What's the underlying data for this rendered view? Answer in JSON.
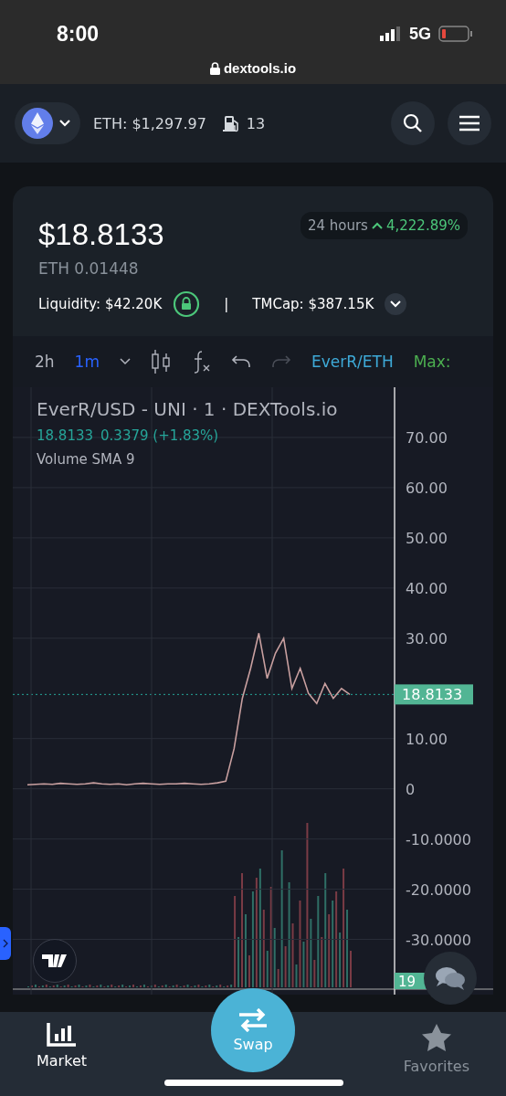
{
  "status_bar": {
    "time": "8:00",
    "network": "5G"
  },
  "address_bar": {
    "url": "dextools.io"
  },
  "header": {
    "eth_price": "ETH: $1,297.97",
    "gas": "13"
  },
  "token": {
    "price": "$18.8133",
    "eth_price": "ETH 0.01448",
    "period": "24 hours",
    "change": "4,222.89%",
    "liquidity": "Liquidity: $42.20K",
    "separator": "|",
    "tmcap": "TMCap: $387.15K"
  },
  "toolbar": {
    "range": "2h",
    "interval": "1m",
    "pair": "EverR/ETH",
    "max": "Max:"
  },
  "chart": {
    "title": "EverR/USD - UNI · 1 · DEXTools.io",
    "last": "18.8133",
    "change": "0.3379 (+1.83%)",
    "indicator": "Volume SMA 9",
    "price_tag": "18.8133",
    "volume_tag": "19",
    "chart_data": {
      "type": "line",
      "ylim": [
        -41,
        80
      ],
      "grid": true,
      "yticks": [
        {
          "value": 70,
          "label": "70.00"
        },
        {
          "value": 60,
          "label": "60.00"
        },
        {
          "value": 50,
          "label": "50.00"
        },
        {
          "value": 40,
          "label": "40.00"
        },
        {
          "value": 30,
          "label": "30.00"
        },
        {
          "value": 10,
          "label": "10.00"
        },
        {
          "value": 0,
          "label": "0"
        },
        {
          "value": -10,
          "label": "-10.0000"
        },
        {
          "value": -20,
          "label": "-20.0000"
        },
        {
          "value": -30,
          "label": "-30.0000"
        }
      ],
      "values": [
        0.8,
        0.9,
        1.0,
        0.9,
        1.1,
        1.0,
        0.9,
        1.0,
        1.2,
        1.0,
        0.9,
        1.0,
        0.8,
        1.0,
        1.1,
        1.0,
        0.9,
        1.0,
        1.0,
        1.1,
        1.0,
        0.9,
        1.0,
        1.2,
        1.5,
        8,
        18,
        24,
        31,
        22,
        27,
        30,
        20,
        24,
        19,
        17,
        21,
        18,
        20,
        18.8
      ]
    }
  },
  "nav": [
    {
      "label": "Market",
      "selected": true
    },
    {
      "label": "Favorites",
      "selected": false
    }
  ],
  "swap": "Swap"
}
